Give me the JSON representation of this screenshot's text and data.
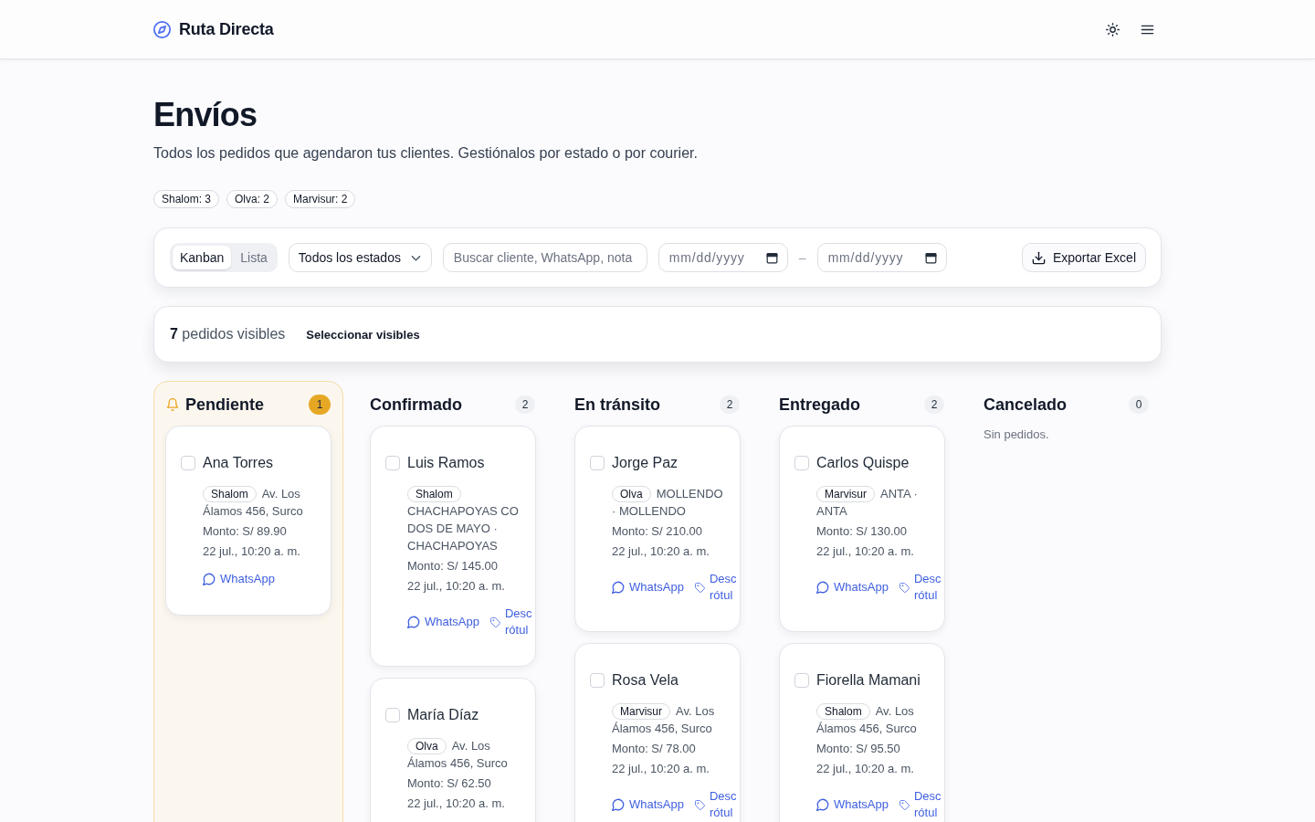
{
  "header": {
    "brand": "Ruta Directa"
  },
  "page": {
    "title": "Envíos",
    "subtitle": "Todos los pedidos que agendaron tus clientes. Gestiónalos por estado o por courier."
  },
  "courier_counts": [
    "Shalom: 3",
    "Olva: 2",
    "Marvisur: 2"
  ],
  "toolbar": {
    "view_tabs": [
      {
        "label": "Kanban",
        "selected": true
      },
      {
        "label": "Lista",
        "selected": false
      }
    ],
    "status_filter": {
      "value": "Todos los estados"
    },
    "search": {
      "placeholder": "Buscar cliente, WhatsApp, nota"
    },
    "date_from": {
      "placeholder": "mm/dd/yyyy"
    },
    "date_separator": "–",
    "date_to": {
      "placeholder": "mm/dd/yyyy"
    },
    "export_button": "Exportar Excel"
  },
  "summary": {
    "text": "**7** pedidos visibles",
    "select_button": "Seleccionar visibles"
  },
  "columns": [
    {
      "title": "Pendiente",
      "count": "1",
      "highlighted": true,
      "orders": [
        {
          "name": "Ana Torres",
          "checked": false,
          "courier": "Shalom",
          "address": "Av. Los Álamos 456, Surco",
          "amount": "Monto: S/ 89.90",
          "date": "22 jul., 10:20 a. m.",
          "whatsapp": "WhatsApp"
        }
      ]
    },
    {
      "title": "Confirmado",
      "count": "2",
      "highlighted": false,
      "orders": [
        {
          "name": "Luis Ramos",
          "checked": false,
          "courier": "Shalom",
          "address": "CHACHAPOYAS CO DOS DE MAYO · CHACHAPOYAS",
          "amount": "Monto: S/ 145.00",
          "date": "22 jul., 10:20 a. m.",
          "whatsapp": "WhatsApp",
          "label_link": "Desc rótul"
        },
        {
          "name": "María Díaz",
          "checked": false,
          "courier": "Olva",
          "address": "Av. Los Álamos 456, Surco",
          "amount": "Monto: S/ 62.50",
          "date": "22 jul., 10:20 a. m."
        }
      ]
    },
    {
      "title": "En tránsito",
      "count": "2",
      "highlighted": false,
      "orders": [
        {
          "name": "Jorge Paz",
          "checked": false,
          "courier": "Olva",
          "address": "MOLLENDO · MOLLENDO",
          "amount": "Monto: S/ 210.00",
          "date": "22 jul., 10:20 a. m.",
          "whatsapp": "WhatsApp",
          "label_link": "Desc rótul"
        },
        {
          "name": "Rosa Vela",
          "checked": false,
          "courier": "Marvisur",
          "address": "Av. Los Álamos 456, Surco",
          "amount": "Monto: S/ 78.00",
          "date": "22 jul., 10:20 a. m.",
          "whatsapp": "WhatsApp",
          "label_link": "Desc rótul"
        }
      ]
    },
    {
      "title": "Entregado",
      "count": "2",
      "highlighted": false,
      "orders": [
        {
          "name": "Carlos Quispe",
          "checked": false,
          "courier": "Marvisur",
          "address": "ANTA · ANTA",
          "amount": "Monto: S/ 130.00",
          "date": "22 jul., 10:20 a. m.",
          "whatsapp": "WhatsApp",
          "label_link": "Desc rótul"
        },
        {
          "name": "Fiorella Mamani",
          "checked": false,
          "courier": "Shalom",
          "address": "Av. Los Álamos 456, Surco",
          "amount": "Monto: S/ 95.50",
          "date": "22 jul., 10:20 a. m.",
          "whatsapp": "WhatsApp",
          "label_link": "Desc rótul"
        }
      ]
    },
    {
      "title": "Cancelado",
      "count": "0",
      "highlighted": false,
      "empty_text": "Sin pedidos."
    }
  ]
}
